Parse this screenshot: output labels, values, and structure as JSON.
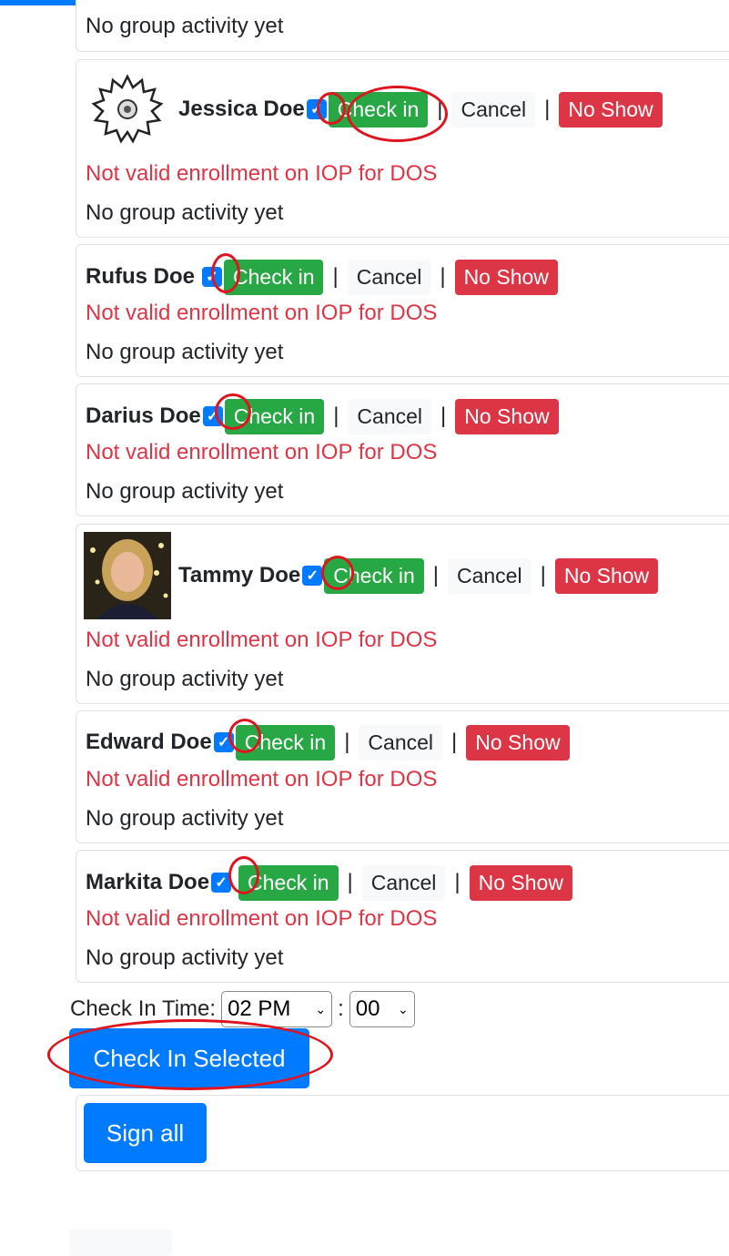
{
  "colors": {
    "primary": "#007bff",
    "success": "#28a745",
    "danger": "#dc3545",
    "light": "#f8f9fa",
    "annotation": "#e0141e"
  },
  "top_card": {
    "activity": "No group activity yet"
  },
  "patients": [
    {
      "name": "Jessica Doe",
      "avatar": "flower-avatar",
      "checked": true,
      "check_in": "Check in",
      "cancel": "Cancel",
      "no_show": "No Show",
      "separator": "|",
      "status": "Not valid enrollment on IOP for DOS",
      "activity": "No group activity yet"
    },
    {
      "name": "Rufus Doe",
      "avatar": null,
      "checked": true,
      "check_in": "Check in",
      "cancel": "Cancel",
      "no_show": "No Show",
      "separator": "|",
      "status": "Not valid enrollment on IOP for DOS",
      "activity": "No group activity yet"
    },
    {
      "name": "Darius Doe",
      "avatar": null,
      "checked": true,
      "check_in": "Check in",
      "cancel": "Cancel",
      "no_show": "No Show",
      "separator": "|",
      "status": "Not valid enrollment on IOP for DOS",
      "activity": "No group activity yet"
    },
    {
      "name": "Tammy Doe",
      "avatar": "photo-avatar",
      "checked": true,
      "check_in": "Check in",
      "cancel": "Cancel",
      "no_show": "No Show",
      "separator": "|",
      "status": "Not valid enrollment on IOP for DOS",
      "activity": "No group activity yet"
    },
    {
      "name": "Edward Doe",
      "avatar": null,
      "checked": true,
      "check_in": "Check in",
      "cancel": "Cancel",
      "no_show": "No Show",
      "separator": "|",
      "status": "Not valid enrollment on IOP for DOS",
      "activity": "No group activity yet"
    },
    {
      "name": "Markita Doe",
      "avatar": null,
      "checked": true,
      "check_in": "Check in",
      "cancel": "Cancel",
      "no_show": "No Show",
      "separator": "|",
      "status": "Not valid enrollment on IOP for DOS",
      "activity": "No group activity yet"
    }
  ],
  "check_in_time": {
    "label": "Check In Time:",
    "hour": "02 PM",
    "colon": ":",
    "minute": "00"
  },
  "check_in_selected_label": "Check In Selected",
  "sign_all_label": "Sign all",
  "check_mark": "✓",
  "caret": "⌄"
}
